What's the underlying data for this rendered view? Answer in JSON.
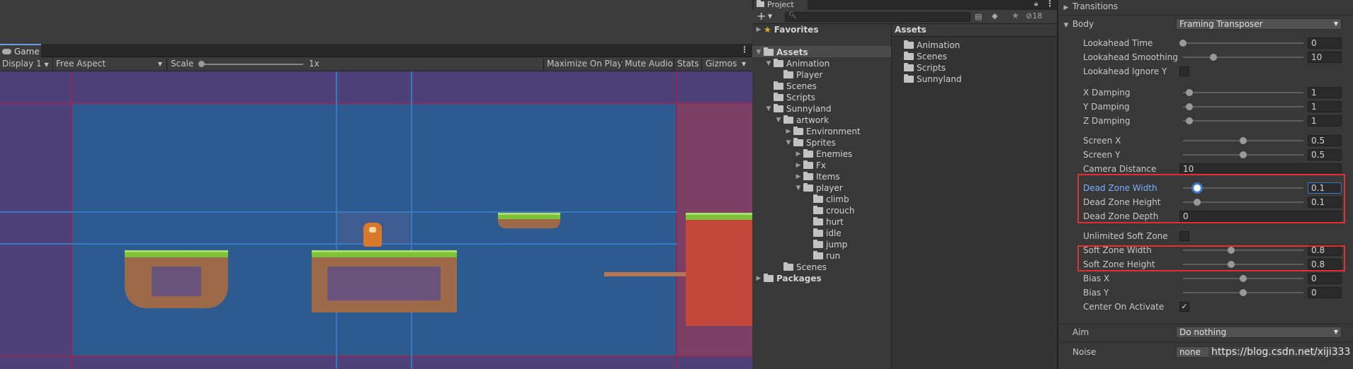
{
  "game": {
    "tab_label": "Game",
    "display": "Display 1",
    "aspect": "Free Aspect",
    "scale_label": "Scale",
    "scale_value": "1x",
    "maximize": "Maximize On Play",
    "mute": "Mute Audio",
    "stats": "Stats",
    "gizmos": "Gizmos"
  },
  "project": {
    "tab_label": "Project",
    "hidden_count": "18",
    "favorites": "Favorites",
    "assets_header": "Assets",
    "tree": [
      {
        "label": "Assets",
        "depth": 0,
        "arrow": "down",
        "bold": true
      },
      {
        "label": "Animation",
        "depth": 1,
        "arrow": "down"
      },
      {
        "label": "Player",
        "depth": 2,
        "arrow": ""
      },
      {
        "label": "Scenes",
        "depth": 1,
        "arrow": ""
      },
      {
        "label": "Scripts",
        "depth": 1,
        "arrow": ""
      },
      {
        "label": "Sunnyland",
        "depth": 1,
        "arrow": "down"
      },
      {
        "label": "artwork",
        "depth": 2,
        "arrow": "down"
      },
      {
        "label": "Environment",
        "depth": 3,
        "arrow": "right"
      },
      {
        "label": "Sprites",
        "depth": 3,
        "arrow": "down"
      },
      {
        "label": "Enemies",
        "depth": 4,
        "arrow": "right"
      },
      {
        "label": "Fx",
        "depth": 4,
        "arrow": "right"
      },
      {
        "label": "Items",
        "depth": 4,
        "arrow": "right"
      },
      {
        "label": "player",
        "depth": 4,
        "arrow": "down"
      },
      {
        "label": "climb",
        "depth": 5,
        "arrow": ""
      },
      {
        "label": "crouch",
        "depth": 5,
        "arrow": ""
      },
      {
        "label": "hurt",
        "depth": 5,
        "arrow": ""
      },
      {
        "label": "idle",
        "depth": 5,
        "arrow": ""
      },
      {
        "label": "jump",
        "depth": 5,
        "arrow": ""
      },
      {
        "label": "run",
        "depth": 5,
        "arrow": ""
      },
      {
        "label": "Scenes",
        "depth": 2,
        "arrow": ""
      },
      {
        "label": "Packages",
        "depth": 0,
        "arrow": "right",
        "bold": true
      }
    ],
    "assets": [
      "Animation",
      "Scenes",
      "Scripts",
      "Sunnyland"
    ]
  },
  "inspector": {
    "transitions": "Transitions",
    "body_label": "Body",
    "body_value": "Framing Transposer",
    "rows": [
      {
        "label": "Lookahead Time",
        "value": "0",
        "slider": 0.0
      },
      {
        "label": "Lookahead Smoothing",
        "value": "10",
        "slider": 0.25
      },
      {
        "label": "Lookahead Ignore Y",
        "check": false
      },
      {
        "label": "X Damping",
        "value": "1",
        "slider": 0.05
      },
      {
        "label": "Y Damping",
        "value": "1",
        "slider": 0.05
      },
      {
        "label": "Z Damping",
        "value": "1",
        "slider": 0.05
      },
      {
        "label": "Screen X",
        "value": "0.5",
        "slider": 0.5
      },
      {
        "label": "Screen Y",
        "value": "0.5",
        "slider": 0.5
      },
      {
        "label": "Camera Distance",
        "value": "10"
      },
      {
        "label": "Dead Zone Width",
        "value": "0.1",
        "slider": 0.12,
        "active": true
      },
      {
        "label": "Dead Zone Height",
        "value": "0.1",
        "slider": 0.12
      },
      {
        "label": "Dead Zone Depth",
        "value": "0"
      },
      {
        "label": "Unlimited Soft Zone",
        "check": false
      },
      {
        "label": "Soft Zone Width",
        "value": "0.8",
        "slider": 0.4
      },
      {
        "label": "Soft Zone Height",
        "value": "0.8",
        "slider": 0.4
      },
      {
        "label": "Bias X",
        "value": "0",
        "slider": 0.5
      },
      {
        "label": "Bias Y",
        "value": "0",
        "slider": 0.5
      },
      {
        "label": "Center On Activate",
        "check": true
      }
    ],
    "aim_label": "Aim",
    "aim_value": "Do nothing",
    "noise_label": "Noise",
    "noise_value": "none"
  },
  "watermark": "https://blog.csdn.net/xiji333"
}
